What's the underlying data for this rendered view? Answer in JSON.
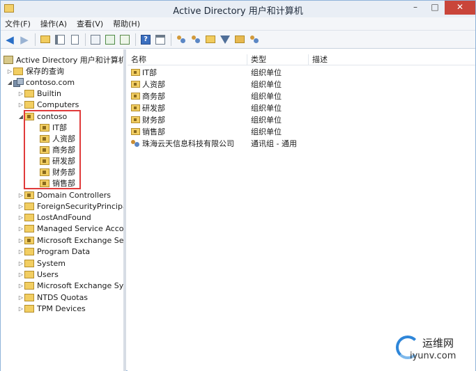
{
  "window": {
    "title": "Active Directory 用户和计算机"
  },
  "window_buttons": {
    "minimize": "–",
    "maximize": "□",
    "close": "✕"
  },
  "menu": [
    "文件(F)",
    "操作(A)",
    "查看(V)",
    "帮助(H)"
  ],
  "toolbar": [
    "back-arrow-icon",
    "forward-arrow-icon",
    "up-folder-icon",
    "show-tree-icon",
    "copy-icon",
    "properties-icon",
    "refresh-icon",
    "export-icon",
    "help-icon",
    "view-icon",
    "new-user-icon",
    "new-group-icon",
    "new-ou-icon",
    "filter-icon",
    "delegate-icon",
    "find-icon"
  ],
  "tree": {
    "root": "Active Directory 用户和计算机",
    "saved_queries": "保存的查询",
    "domain": "contoso.com",
    "items": [
      {
        "label": "Builtin"
      },
      {
        "label": "Computers"
      },
      {
        "label": "contoso"
      },
      {
        "label": "IT部"
      },
      {
        "label": "人资部"
      },
      {
        "label": "商务部"
      },
      {
        "label": "研发部"
      },
      {
        "label": "财务部"
      },
      {
        "label": "销售部"
      },
      {
        "label": "Domain Controllers"
      },
      {
        "label": "ForeignSecurityPrincipa"
      },
      {
        "label": "LostAndFound"
      },
      {
        "label": "Managed Service Acco"
      },
      {
        "label": "Microsoft Exchange Se"
      },
      {
        "label": "Program Data"
      },
      {
        "label": "System"
      },
      {
        "label": "Users"
      },
      {
        "label": "Microsoft Exchange Sy"
      },
      {
        "label": "NTDS Quotas"
      },
      {
        "label": "TPM Devices"
      }
    ]
  },
  "list": {
    "columns": {
      "name": "名称",
      "type": "类型",
      "desc": "描述"
    },
    "rows": [
      {
        "name": "IT部",
        "type": "组织单位"
      },
      {
        "name": "人资部",
        "type": "组织单位"
      },
      {
        "name": "商务部",
        "type": "组织单位"
      },
      {
        "name": "研发部",
        "type": "组织单位"
      },
      {
        "name": "财务部",
        "type": "组织单位"
      },
      {
        "name": "销售部",
        "type": "组织单位"
      },
      {
        "name": "珠海云天信息科技有限公司",
        "type": "通讯组 - 通用"
      }
    ]
  },
  "watermark": {
    "line1": "运维网",
    "line2": "iyunv.com"
  }
}
